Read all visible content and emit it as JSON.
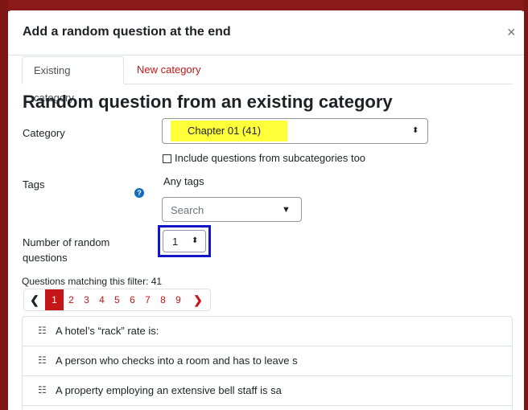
{
  "modal": {
    "title": "Add a random question at the end",
    "close_glyph": "×"
  },
  "tabs": [
    {
      "label": "Existing category",
      "active": true
    },
    {
      "label": "New category",
      "active": false
    }
  ],
  "heading": "Random question from an existing category",
  "category": {
    "label": "Category",
    "selected": "Chapter 01 (41)",
    "highlight_color": "#ffff3a"
  },
  "subcategories": {
    "label": "Include questions from subcategories too",
    "checked": false
  },
  "tags": {
    "label": "Tags",
    "help_icon": "question-circle-icon",
    "help_glyph": "?",
    "value": "Any tags",
    "search_placeholder": "Search",
    "dropdown_glyph": "▼"
  },
  "number_random": {
    "label_line1": "Number of random",
    "label_line2": "questions",
    "selected": "1",
    "outline_color": "#1515c8"
  },
  "matching": {
    "text": "Questions matching this filter: 41"
  },
  "pagination": {
    "prev_glyph": "❮",
    "next_glyph": "❯",
    "pages": [
      "1",
      "2",
      "3",
      "4",
      "5",
      "6",
      "7",
      "8",
      "9"
    ],
    "current": "1",
    "accent_color": "#c41616"
  },
  "questions": [
    {
      "icon": "multichoice-icon",
      "glyph": "☷",
      "text": "A hotel’s “rack” rate is:"
    },
    {
      "icon": "multichoice-icon",
      "glyph": "☷",
      "text": "A person who checks into a room and has to leave s"
    },
    {
      "icon": "multichoice-icon",
      "glyph": "☷",
      "text": "A property employing an extensive bell staff is sa"
    }
  ]
}
